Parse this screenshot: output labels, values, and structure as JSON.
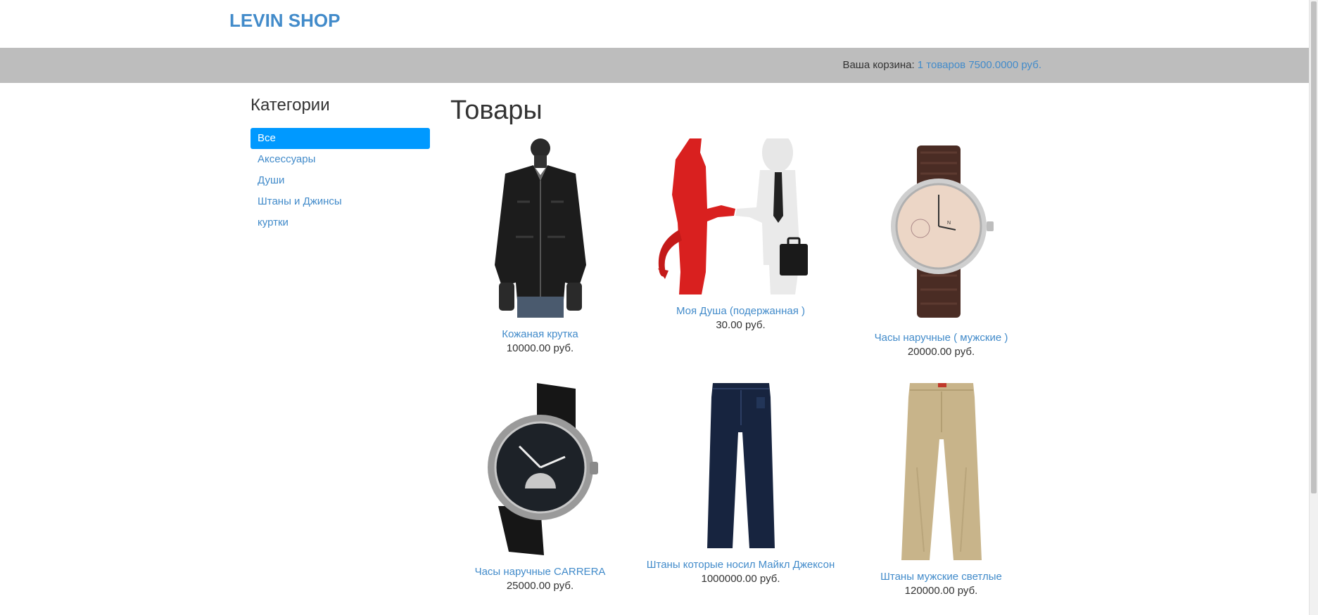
{
  "brand": "LEVIN SHOP",
  "cart": {
    "label": "Ваша корзина:",
    "summary": "1 товаров 7500.0000 руб."
  },
  "sidebar": {
    "title": "Категории",
    "items": [
      {
        "label": "Все",
        "active": true
      },
      {
        "label": "Аксессуары"
      },
      {
        "label": "Души"
      },
      {
        "label": "Штаны и Джинсы"
      },
      {
        "label": "куртки"
      }
    ]
  },
  "main": {
    "title": "Товары",
    "products": [
      {
        "name": "Кожаная крутка",
        "price": "10000.00 руб.",
        "image": "leather-jacket"
      },
      {
        "name": "Моя Душа (подержанная )",
        "price": "30.00 руб.",
        "image": "devil-handshake"
      },
      {
        "name": "Часы наручные ( мужские )",
        "price": "20000.00 руб.",
        "image": "brown-watch"
      },
      {
        "name": "Часы наручные CARRERA",
        "price": "25000.00 руб.",
        "image": "black-watch"
      },
      {
        "name": "Штаны которые носил Майкл Джексон",
        "price": "1000000.00 руб.",
        "image": "dark-jeans"
      },
      {
        "name": "Штаны мужские светлые",
        "price": "120000.00 руб.",
        "image": "khaki-pants"
      }
    ]
  },
  "colors": {
    "brand": "#428bca",
    "active_category": "#0099ff",
    "cart_bar": "#bdbdbd"
  }
}
